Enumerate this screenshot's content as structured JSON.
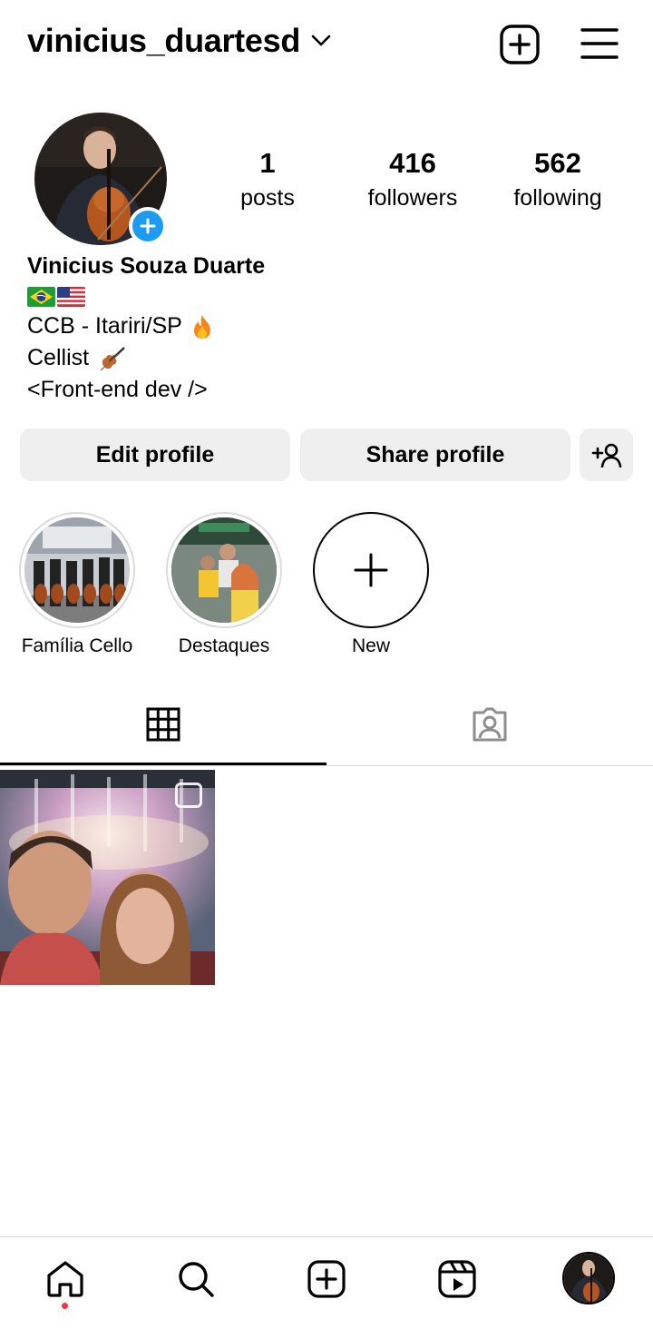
{
  "header": {
    "username": "vinicius_duartesd"
  },
  "profile": {
    "stats": {
      "posts_count": "1",
      "posts_label": "posts",
      "followers_count": "416",
      "followers_label": "followers",
      "following_count": "562",
      "following_label": "following"
    },
    "name": "Vinicius Souza Duarte",
    "bio_lines": [
      "CCB - Itariri/SP",
      "Cellist",
      "<Front-end dev />"
    ]
  },
  "actions": {
    "edit_label": "Edit profile",
    "share_label": "Share profile"
  },
  "highlights": [
    {
      "label": "Família Cello"
    },
    {
      "label": "Destaques"
    },
    {
      "label": "New"
    }
  ],
  "tabs": [
    {
      "icon": "grid-icon",
      "active": true
    },
    {
      "icon": "tagged-icon",
      "active": false
    }
  ],
  "bottom_nav": [
    {
      "icon": "home-icon",
      "active": true
    },
    {
      "icon": "search-icon"
    },
    {
      "icon": "create-icon"
    },
    {
      "icon": "reels-icon"
    },
    {
      "icon": "profile-avatar"
    }
  ],
  "colors": {
    "accent_blue": "#1d9bf0",
    "button_bg": "#efefef",
    "notification_dot": "#ff3040"
  }
}
